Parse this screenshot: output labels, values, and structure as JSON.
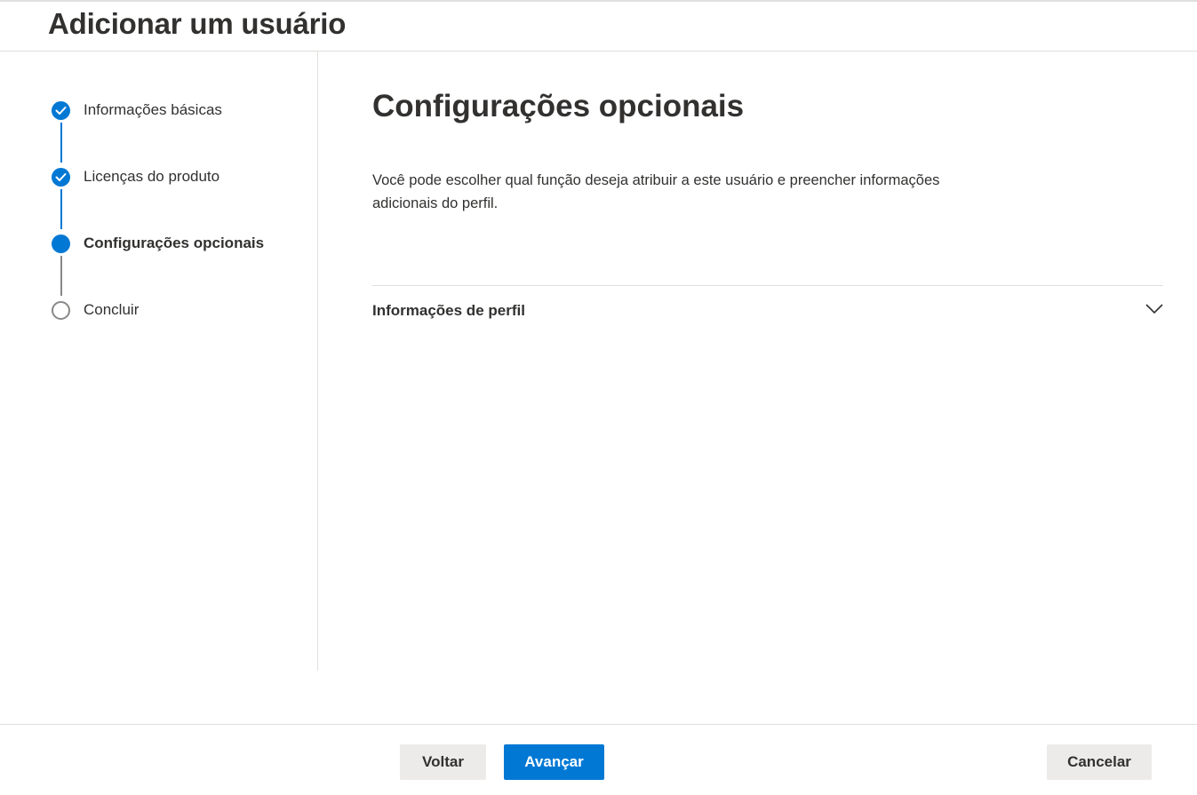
{
  "header": {
    "title": "Adicionar um usuário"
  },
  "steps": [
    {
      "label": "Informações básicas",
      "status": "completed",
      "icon": "check-icon"
    },
    {
      "label": "Licenças do produto",
      "status": "completed",
      "icon": "check-icon"
    },
    {
      "label": "Configurações opcionais",
      "status": "current"
    },
    {
      "label": "Concluir",
      "status": "pending"
    }
  ],
  "main": {
    "title": "Configurações opcionais",
    "description": "Você pode escolher qual função deseja atribuir a este usuário e preencher informações adicionais do perfil.",
    "sections": [
      {
        "label": "Informações de perfil",
        "expanded": false,
        "icon": "chevron-down-icon"
      }
    ]
  },
  "footer": {
    "back_label": "Voltar",
    "next_label": "Avançar",
    "cancel_label": "Cancelar"
  },
  "colors": {
    "accent": "#0078d4",
    "border": "#e1dfdd",
    "text": "#323130",
    "pending": "#8a8886",
    "secondary_button": "#edebe9"
  }
}
